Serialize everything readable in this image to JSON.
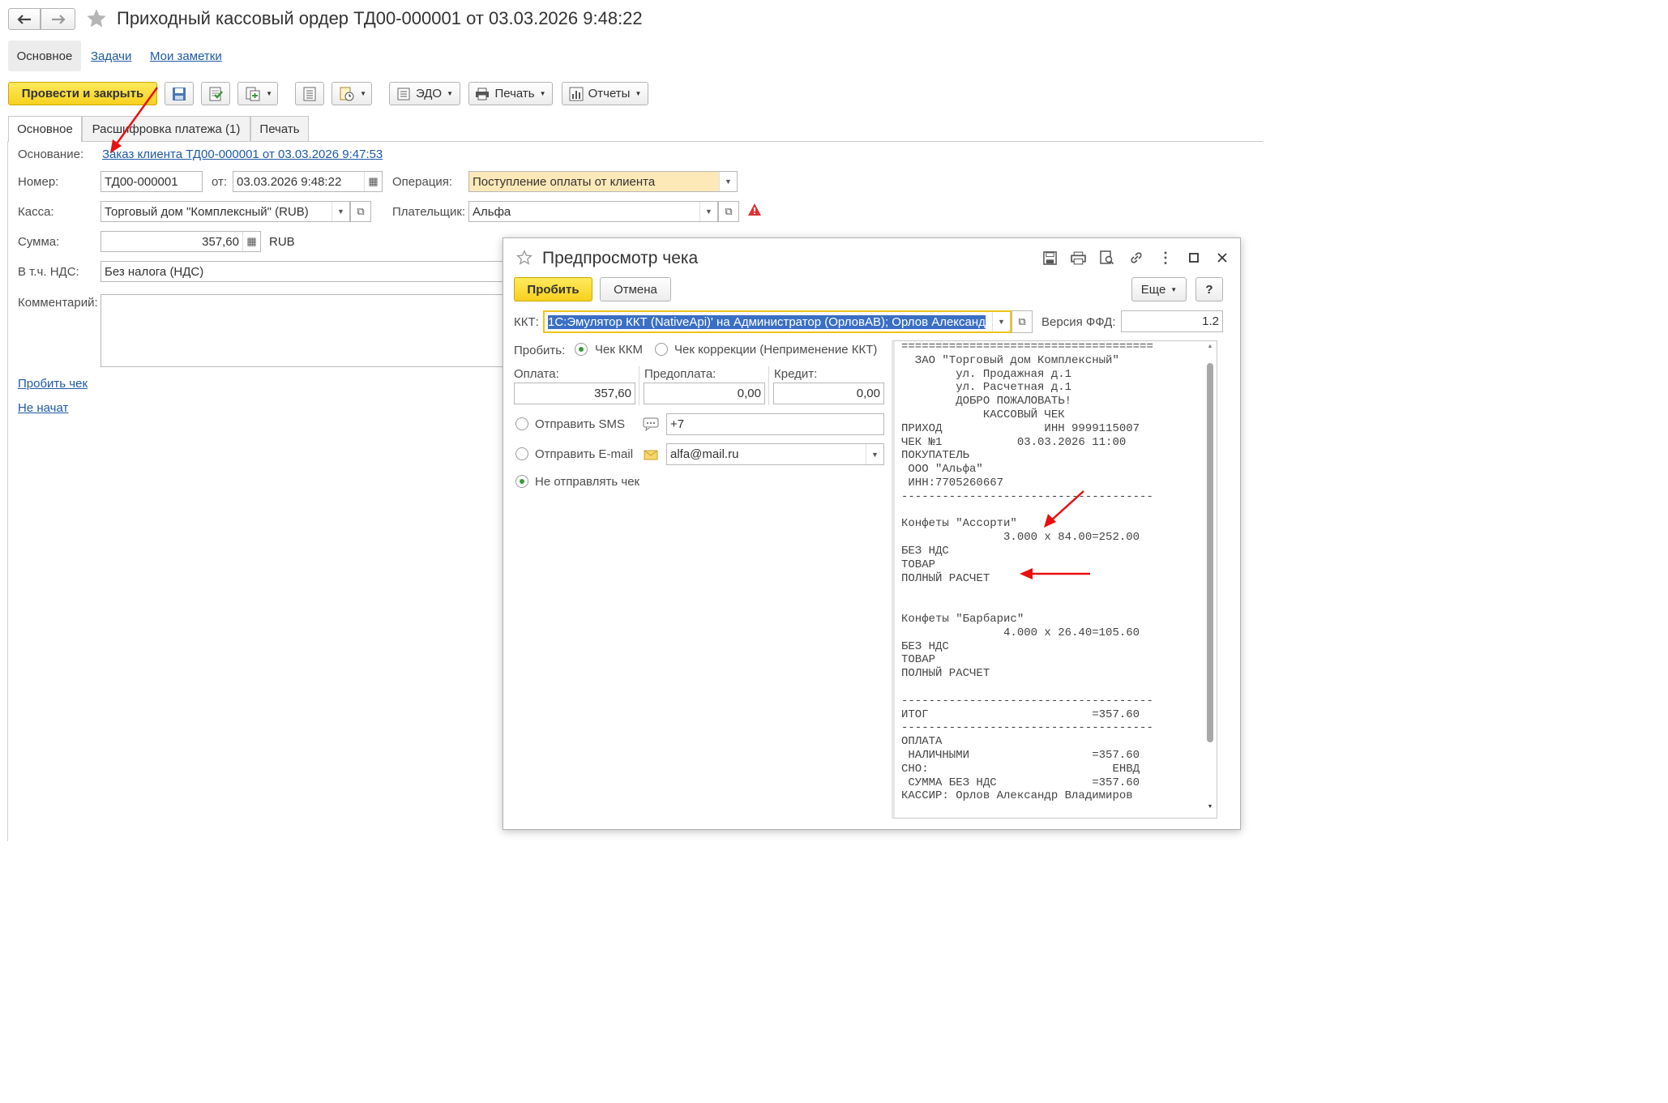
{
  "window": {
    "title": "Приходный кассовый ордер ТД00-000001 от 03.03.2026 9:48:22",
    "nav_tabs": [
      "Основное",
      "Задачи",
      "Мои заметки"
    ]
  },
  "toolbar": {
    "post_close": "Провести и закрыть",
    "edo": "ЭДО",
    "print": "Печать",
    "reports": "Отчеты"
  },
  "form_tabs": [
    "Основное",
    "Расшифровка платежа (1)",
    "Печать"
  ],
  "form": {
    "basis_label": "Основание:",
    "basis_link": "Заказ клиента ТД00-000001 от 03.03.2026 9:47:53",
    "number_label": "Номер:",
    "number": "ТД00-000001",
    "date_label": "от:",
    "date": "03.03.2026  9:48:22",
    "operation_label": "Операция:",
    "operation": "Поступление оплаты от клиента",
    "cash_label": "Касса:",
    "cash": "Торговый дом \"Комплексный\" (RUB)",
    "payer_label": "Плательщик:",
    "payer": "Альфа",
    "sum_label": "Сумма:",
    "sum": "357,60",
    "currency": "RUB",
    "vat_label": "В т.ч. НДС:",
    "vat": "Без налога (НДС)",
    "comment_label": "Комментарий:",
    "punch_link": "Пробить чек",
    "status_link": "Не начат"
  },
  "dialog": {
    "title": "Предпросмотр чека",
    "punch_btn": "Пробить",
    "cancel_btn": "Отмена",
    "more_btn": "Еще",
    "help_btn": "?",
    "kkt_label": "ККТ:",
    "kkt": "1С:Эмулятор ККТ (NativeApi)' на Администратор (ОрловАВ); Орлов Александ",
    "ffd_label": "Версия ФФД:",
    "ffd": "1.2",
    "punch_label": "Пробить:",
    "radio_kkm": "Чек ККМ",
    "radio_corr": "Чек коррекции (Неприменение ККТ)",
    "pay_label": "Оплата:",
    "pay": "357,60",
    "prepay_label": "Предоплата:",
    "prepay": "0,00",
    "credit_label": "Кредит:",
    "credit": "0,00",
    "sms_label": "Отправить SMS",
    "sms": "+7",
    "email_label": "Отправить E-mail",
    "email": "alfa@mail.ru",
    "nosend_label": "Не отправлять чек"
  },
  "receipt": [
    "=====================================",
    "  ЗАО \"Торговый дом Комплексный\"",
    "        ул. Продажная д.1",
    "        ул. Расчетная д.1",
    "        ДОБРО ПОЖАЛОВАТЬ!",
    "            КАССОВЫЙ ЧЕК",
    "ПРИХОД               ИНН 9999115007",
    "ЧЕК №1           03.03.2026 11:00",
    "ПОКУПАТЕЛЬ",
    " ООО \"Альфа\"",
    " ИНН:7705260667",
    "-------------------------------------",
    "",
    "Конфеты \"Ассорти\"",
    "               3.000 x 84.00=252.00",
    "БЕЗ НДС",
    "ТОВАР",
    "ПОЛНЫЙ РАСЧЕТ",
    "",
    "",
    "Конфеты \"Барбарис\"",
    "               4.000 x 26.40=105.60",
    "БЕЗ НДС",
    "ТОВАР",
    "ПОЛНЫЙ РАСЧЕТ",
    "",
    "-------------------------------------",
    "ИТОГ                        =357.60",
    "-------------------------------------",
    "ОПЛАТА",
    " НАЛИЧНЫМИ                  =357.60",
    "СНО:                           ЕНВД",
    " СУММА БЕЗ НДС              =357.60",
    "КАССИР: Орлов Александр Владимиров"
  ],
  "colors": {
    "accent_yellow": "#f7d11f",
    "link": "#1f5aa6",
    "annotation": "#e81010"
  }
}
